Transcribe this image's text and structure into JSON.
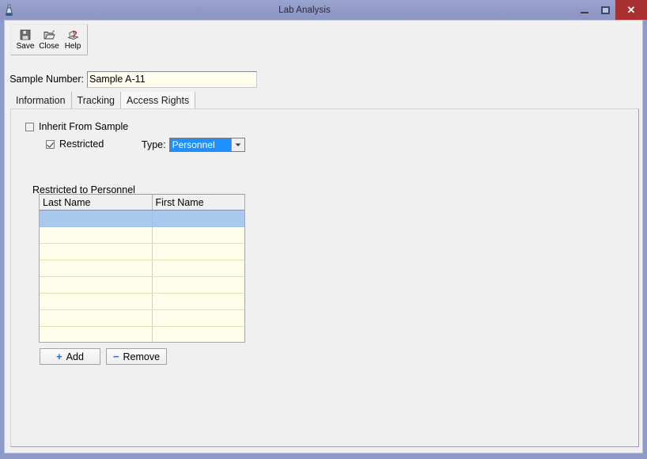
{
  "window": {
    "title": "Lab Analysis",
    "icon": "flask-icon",
    "controls": {
      "minimize": "minimize-icon",
      "maximize": "maximize-icon",
      "close_label": "✕"
    },
    "colors": {
      "titlebar": "#9299c7",
      "frame": "#8e9ac8",
      "close_button": "#a93030",
      "accent_selection": "#1e90ff",
      "row_selection": "#a8c8ec",
      "field_background": "#fffdeb",
      "plus_minus": "#1e6fd9"
    }
  },
  "toolbar": {
    "buttons": [
      {
        "label": "Save",
        "icon": "floppy-disk-icon"
      },
      {
        "label": "Close",
        "icon": "open-folder-icon"
      },
      {
        "label": "Help",
        "icon": "help-book-icon"
      }
    ]
  },
  "sample": {
    "label": "Sample Number:",
    "value": "Sample A-11",
    "placeholder": ""
  },
  "tabs": [
    {
      "label": "Information",
      "active": false
    },
    {
      "label": "Tracking",
      "active": false
    },
    {
      "label": "Access Rights",
      "active": true
    }
  ],
  "access_rights": {
    "inherit": {
      "label": "Inherit From Sample",
      "checked": false
    },
    "restricted": {
      "label": "Restricted",
      "checked": true
    },
    "type": {
      "label": "Type:",
      "value": "Personnel",
      "options": [
        "Personnel"
      ]
    },
    "restricted_to": {
      "label": "Restricted to  Personnel",
      "columns": [
        "Last Name",
        "First Name"
      ],
      "rows": [
        {
          "last_name": "",
          "first_name": "",
          "selected": true
        },
        {
          "last_name": "",
          "first_name": "",
          "selected": false
        },
        {
          "last_name": "",
          "first_name": "",
          "selected": false
        },
        {
          "last_name": "",
          "first_name": "",
          "selected": false
        },
        {
          "last_name": "",
          "first_name": "",
          "selected": false
        },
        {
          "last_name": "",
          "first_name": "",
          "selected": false
        },
        {
          "last_name": "",
          "first_name": "",
          "selected": false
        },
        {
          "last_name": "",
          "first_name": "",
          "selected": false
        }
      ]
    },
    "actions": {
      "add": {
        "symbol": "+",
        "label": "Add"
      },
      "remove": {
        "symbol": "−",
        "label": "Remove"
      }
    }
  }
}
